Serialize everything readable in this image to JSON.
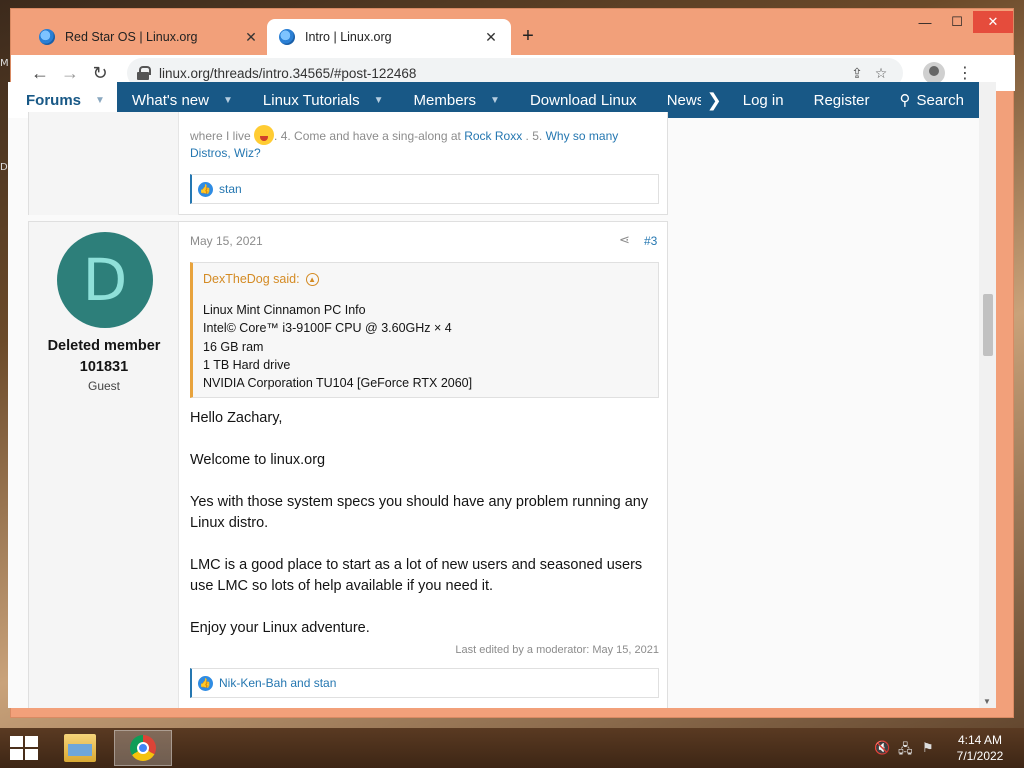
{
  "desktop": {
    "mark_top": "M",
    "mark_mid": "D"
  },
  "browser": {
    "tabs": [
      {
        "title": "Red Star OS | Linux.org",
        "active": false
      },
      {
        "title": "Intro | Linux.org",
        "active": true
      }
    ],
    "new_tab_symbol": "+",
    "window_controls": {
      "minimize": "—",
      "maximize": "☐",
      "close": "✕"
    },
    "url": "linux.org/threads/intro.34565/#post-122468"
  },
  "site_nav": {
    "forums": "Forums",
    "items": [
      "What's new",
      "Linux Tutorials",
      "Members",
      "Download Linux",
      "Newsletter"
    ],
    "login": "Log in",
    "register": "Register",
    "search": "Search"
  },
  "post_prev": {
    "text_before": "where I live",
    "text_middle": ". 4. Come and have a sing-along at",
    "link1": "Rock Roxx",
    "text_after": ". 5.",
    "link2": "Why so many Distros, Wiz?",
    "reactions": "stan"
  },
  "post": {
    "date": "May 15, 2021",
    "number": "#3",
    "avatar_letter": "D",
    "username_line1": "Deleted member",
    "username_line2": "101831",
    "user_title": "Guest",
    "quote": {
      "author": "DexTheDog said:",
      "lines": [
        "Linux Mint Cinnamon PC Info",
        "Intel© Core™ i3-9100F CPU @ 3.60GHz × 4",
        "16 GB ram",
        "1 TB Hard drive",
        "NVIDIA Corporation TU104 [GeForce RTX 2060]"
      ]
    },
    "paragraphs": [
      "Hello Zachary,",
      "Welcome to linux.org",
      "Yes with those system specs you should have any problem running any Linux distro.",
      "LMC is a good place to start as a lot of new users and seasoned users use LMC so lots of help available if you need it.",
      "Enjoy your Linux adventure."
    ],
    "edited": "Last edited by a moderator: May 15, 2021",
    "reactions": "Nik-Ken-Bah and stan"
  },
  "taskbar": {
    "time": "4:14 AM",
    "date": "7/1/2022"
  }
}
